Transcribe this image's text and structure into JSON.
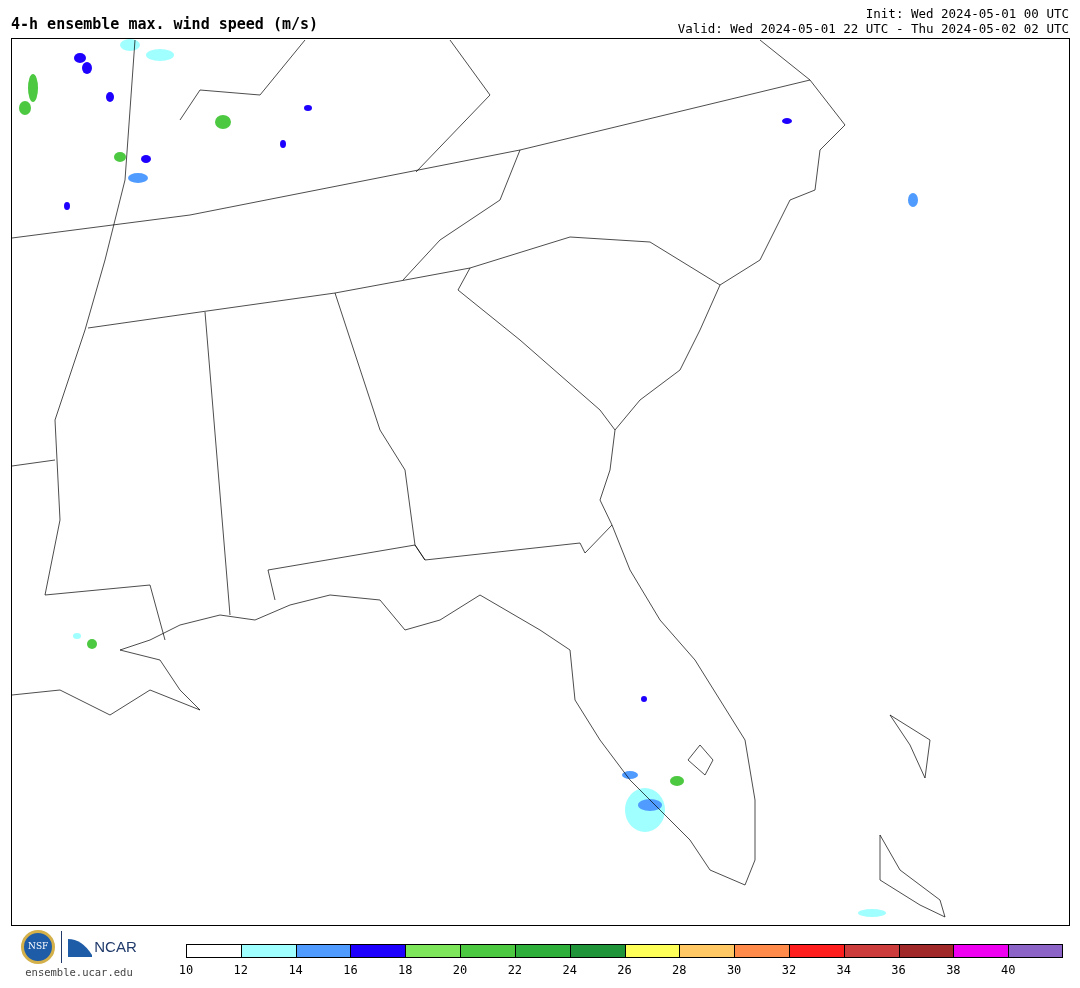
{
  "title": "4-h ensemble max. wind speed (m/s)",
  "init": "Init: Wed 2024-05-01 00 UTC",
  "valid": "Valid: Wed 2024-05-01 22 UTC - Thu 2024-05-02 02 UTC",
  "logos": {
    "nsf": "NSF",
    "ncar": "NCAR",
    "url": "ensemble.ucar.edu"
  },
  "colorbar": [
    {
      "label": "10",
      "color": "#ffffff"
    },
    {
      "label": "12",
      "color": "#a0ffff"
    },
    {
      "label": "14",
      "color": "#4f9bff"
    },
    {
      "label": "16",
      "color": "#1e00ff"
    },
    {
      "label": "18",
      "color": "#7ee65a"
    },
    {
      "label": "20",
      "color": "#4cc841"
    },
    {
      "label": "22",
      "color": "#2eae3a"
    },
    {
      "label": "24",
      "color": "#1f9438"
    },
    {
      "label": "26",
      "color": "#ffff5a"
    },
    {
      "label": "28",
      "color": "#ffc864"
    },
    {
      "label": "30",
      "color": "#ff8a4a"
    },
    {
      "label": "32",
      "color": "#ff1e1e"
    },
    {
      "label": "34",
      "color": "#cc3c3c"
    },
    {
      "label": "36",
      "color": "#a02828"
    },
    {
      "label": "38",
      "color": "#f000f0"
    },
    {
      "label": "40",
      "color": "#8c64c8"
    }
  ]
}
